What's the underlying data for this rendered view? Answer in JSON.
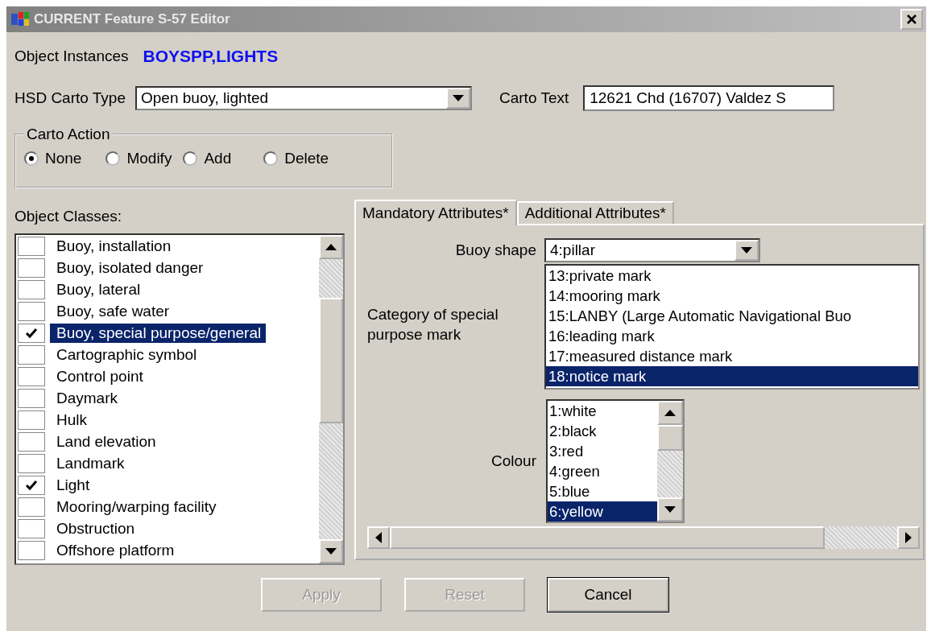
{
  "window": {
    "title": "CURRENT Feature S-57 Editor"
  },
  "object_instances": {
    "label": "Object Instances",
    "value": "BOYSPP,LIGHTS"
  },
  "hsd_carto_type": {
    "label": "HSD Carto Type",
    "value": "Open buoy, lighted"
  },
  "carto_text": {
    "label": "Carto Text",
    "value": "12621 Chd (16707) Valdez S"
  },
  "carto_action": {
    "title": "Carto Action",
    "options": [
      {
        "label": "None",
        "selected": true
      },
      {
        "label": "Modify",
        "selected": false
      },
      {
        "label": "Add",
        "selected": false
      },
      {
        "label": "Delete",
        "selected": false
      }
    ]
  },
  "object_classes": {
    "label": "Object Classes:",
    "items": [
      {
        "label": "Buoy, installation",
        "checked": false,
        "selected": false
      },
      {
        "label": "Buoy, isolated danger",
        "checked": false,
        "selected": false
      },
      {
        "label": "Buoy, lateral",
        "checked": false,
        "selected": false
      },
      {
        "label": "Buoy, safe water",
        "checked": false,
        "selected": false
      },
      {
        "label": "Buoy, special purpose/general",
        "checked": true,
        "selected": true
      },
      {
        "label": "Cartographic symbol",
        "checked": false,
        "selected": false
      },
      {
        "label": "Control point",
        "checked": false,
        "selected": false
      },
      {
        "label": "Daymark",
        "checked": false,
        "selected": false
      },
      {
        "label": "Hulk",
        "checked": false,
        "selected": false
      },
      {
        "label": "Land elevation",
        "checked": false,
        "selected": false
      },
      {
        "label": "Landmark",
        "checked": false,
        "selected": false
      },
      {
        "label": "Light",
        "checked": true,
        "selected": false
      },
      {
        "label": "Mooring/warping facility",
        "checked": false,
        "selected": false
      },
      {
        "label": "Obstruction",
        "checked": false,
        "selected": false
      },
      {
        "label": "Offshore platform",
        "checked": false,
        "selected": false
      }
    ]
  },
  "tabs": [
    {
      "label": "Mandatory Attributes*",
      "selected": true
    },
    {
      "label": "Additional Attributes*",
      "selected": false
    }
  ],
  "attributes": {
    "buoy_shape": {
      "label": "Buoy shape",
      "value": "4:pillar"
    },
    "category": {
      "label": "Category of special purpose mark",
      "items": [
        {
          "label": "13:private mark",
          "selected": false
        },
        {
          "label": "14:mooring mark",
          "selected": false
        },
        {
          "label": "15:LANBY (Large Automatic Navigational Buo",
          "selected": false
        },
        {
          "label": "16:leading mark",
          "selected": false
        },
        {
          "label": "17:measured distance mark",
          "selected": false
        },
        {
          "label": "18:notice mark",
          "selected": true
        }
      ]
    },
    "colour": {
      "label": "Colour",
      "items": [
        {
          "label": "1:white",
          "selected": false
        },
        {
          "label": "2:black",
          "selected": false
        },
        {
          "label": "3:red",
          "selected": false
        },
        {
          "label": "4:green",
          "selected": false
        },
        {
          "label": "5:blue",
          "selected": false
        },
        {
          "label": "6:yellow",
          "selected": true
        }
      ]
    }
  },
  "buttons": [
    {
      "label": "Apply",
      "disabled": true
    },
    {
      "label": "Reset",
      "disabled": true
    },
    {
      "label": "Cancel",
      "disabled": false
    }
  ]
}
